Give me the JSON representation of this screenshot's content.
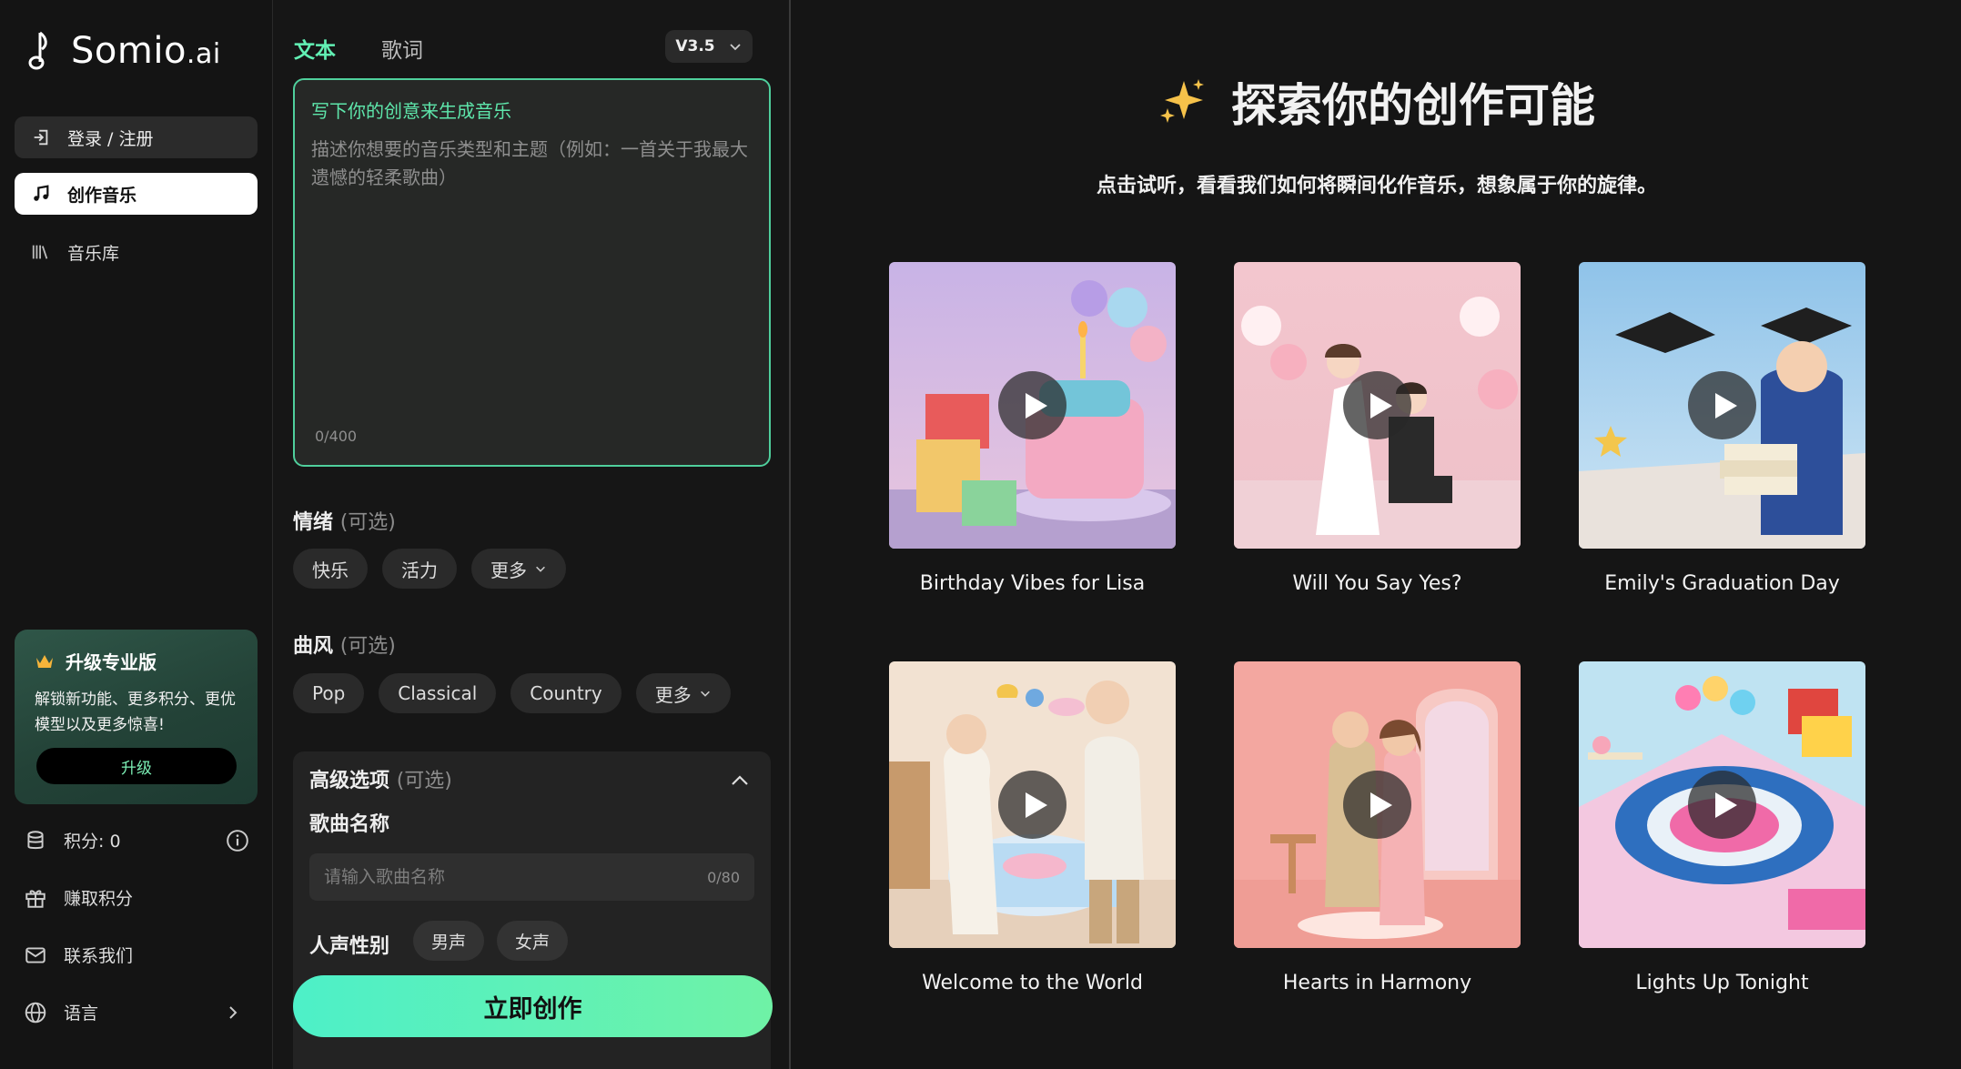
{
  "brand": {
    "name": "Somio",
    "suffix": ".ai"
  },
  "sidebar": {
    "login_label": "登录 / 注册",
    "create_label": "创作音乐",
    "library_label": "音乐库",
    "upgrade": {
      "title": "升级专业版",
      "description": "解锁新功能、更多积分、更优模型以及更多惊喜!",
      "button": "升级"
    },
    "points_label": "积分: 0",
    "earn_label": "赚取积分",
    "contact_label": "联系我们",
    "language_label": "语言"
  },
  "form": {
    "tabs": [
      "文本",
      "歌词"
    ],
    "version": "V3.5",
    "prompt_label": "写下你的创意来生成音乐",
    "prompt_placeholder": "描述你想要的音乐类型和主题（例如：一首关于我最大遗憾的轻柔歌曲）",
    "prompt_counter": "0/400",
    "mood": {
      "title": "情绪",
      "optional": "(可选)",
      "options": [
        "快乐",
        "活力"
      ],
      "more": "更多"
    },
    "genre": {
      "title": "曲风",
      "optional": "(可选)",
      "options": [
        "Pop",
        "Classical",
        "Country"
      ],
      "more": "更多"
    },
    "advanced": {
      "title": "高级选项",
      "optional": "(可选)",
      "song_name_label": "歌曲名称",
      "song_name_placeholder": "请输入歌曲名称",
      "song_name_counter": "0/80",
      "voice_label": "人声性别",
      "voice_options": [
        "男声",
        "女声"
      ]
    },
    "submit_label": "立即创作"
  },
  "main": {
    "headline": "探索你的创作可能",
    "subhead": "点击试听，看看我们如何将瞬间化作音乐，想象属于你的旋律。",
    "cards": [
      {
        "title": "Birthday Vibes for Lisa"
      },
      {
        "title": "Will You Say Yes?"
      },
      {
        "title": "Emily's Graduation Day"
      },
      {
        "title": "Welcome to the World"
      },
      {
        "title": "Hearts in Harmony"
      },
      {
        "title": "Lights Up Tonight"
      }
    ]
  },
  "colors": {
    "accent": "#62f0b4",
    "background": "#151515",
    "panel": "#232323",
    "button_gradient_start": "#4df0c8",
    "button_gradient_end": "#6ff2a6"
  }
}
